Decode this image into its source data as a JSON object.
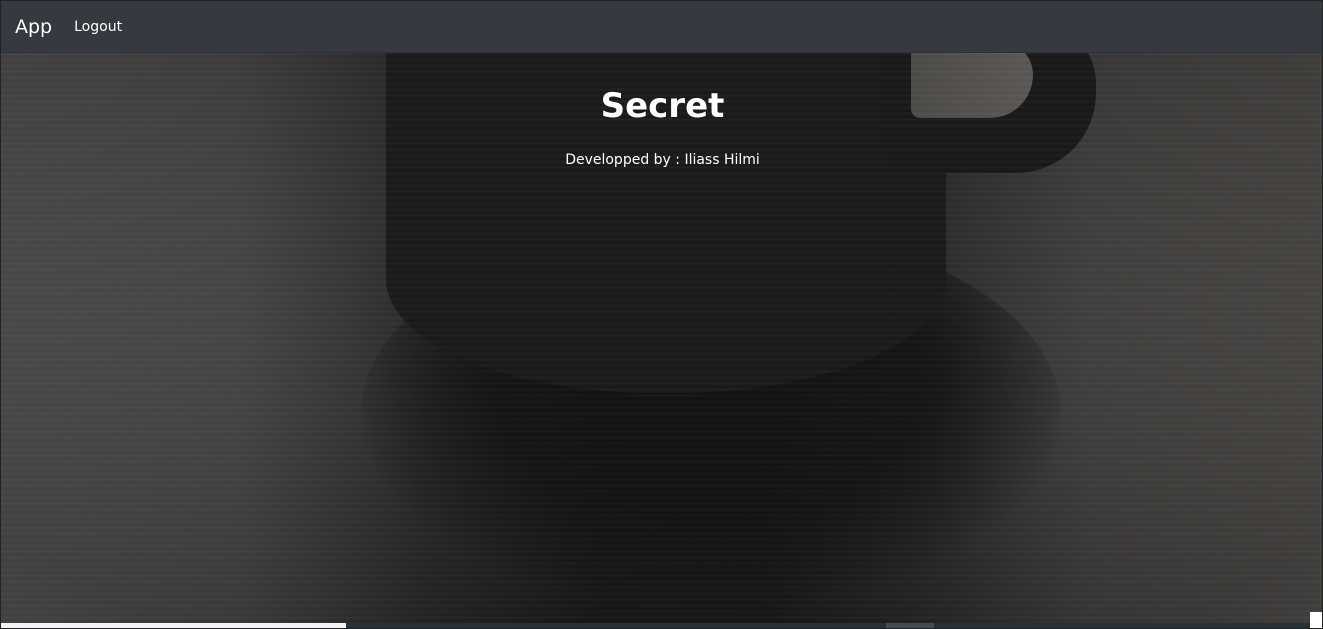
{
  "navbar": {
    "brand": "App",
    "links": [
      {
        "label": "Logout"
      }
    ]
  },
  "hero": {
    "title": "Secret",
    "credit": "Developped by : Iliass Hilmi"
  },
  "colors": {
    "navbar_bg": "#343a40",
    "text": "#ffffff",
    "background_dark": "#1a1a1a"
  }
}
